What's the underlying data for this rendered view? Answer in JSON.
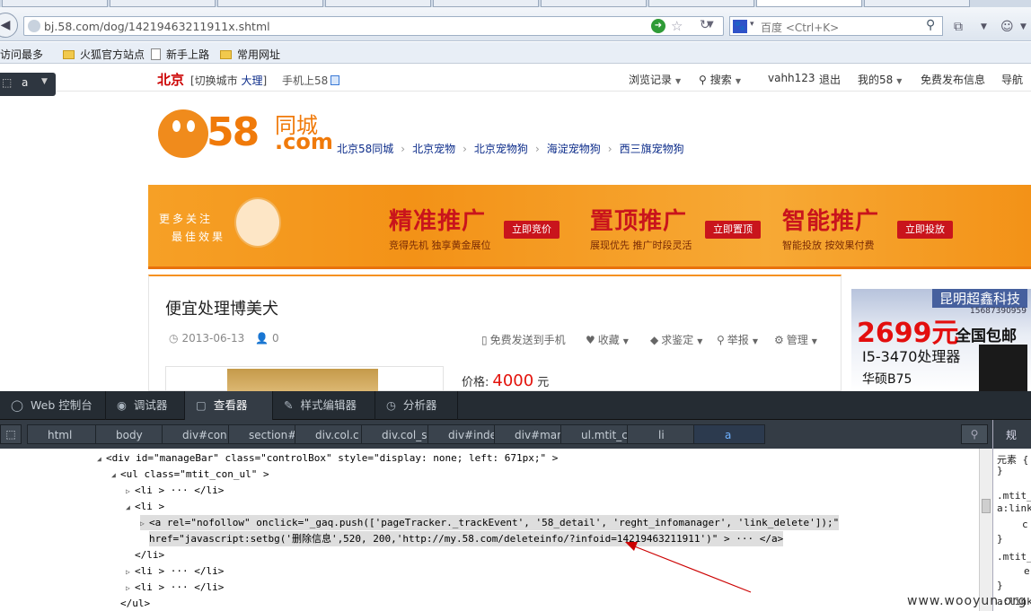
{
  "browser": {
    "url": "bj.58.com/dog/14219463211911x.shtml",
    "search_engine": "百度",
    "search_placeholder": "百度 <Ctrl+K>",
    "bookmarks": [
      "访问最多",
      "火狐官方站点",
      "新手上路",
      "常用网址"
    ]
  },
  "site": {
    "city": "北京",
    "switch_prefix": "[切换城市",
    "switch_city": "大理",
    "switch_suffix": "]",
    "mobile": "手机上58",
    "topnav": [
      "浏览记录",
      "搜索",
      "vahh123",
      "退出",
      "我的58",
      "免费发布信息",
      "导航"
    ],
    "logo_num": "58",
    "logo_cn": "同城",
    "logo_com": ".com",
    "breadcrumb": [
      "北京58同城",
      "北京宠物",
      "北京宠物狗",
      "海淀宠物狗",
      "西三旗宠物狗"
    ],
    "breadcrumb_sep": "›",
    "banner": {
      "side_line1": "更多关注",
      "side_line2": "最佳效果",
      "promos": [
        {
          "big": "精准推广",
          "small": "竞得先机 独享黄金展位",
          "btn": "立即竞价"
        },
        {
          "big": "置顶推广",
          "small": "展现优先 推广时段灵活",
          "btn": "立即置顶"
        },
        {
          "big": "智能推广",
          "small": "智能投放 按效果付费",
          "btn": "立即投放"
        }
      ]
    },
    "post": {
      "title": "便宜处理博美犬",
      "date": "2013-06-13",
      "views": "0",
      "actions": [
        "免费发送到手机",
        "收藏",
        "求鉴定",
        "举报",
        "管理"
      ],
      "price_label": "价格:",
      "price_value": "4000",
      "price_unit": "元"
    },
    "ad": {
      "company": "昆明超鑫科技",
      "phone": "15687390959",
      "price": "2699元",
      "all": "全国包邮",
      "cpu": "I5-3470处理器",
      "board": "华硕B75"
    }
  },
  "devtools": {
    "tabs": [
      {
        "icon": "◯",
        "label": "Web 控制台"
      },
      {
        "icon": "◉",
        "label": "调试器"
      },
      {
        "icon": "▢",
        "label": "查看器"
      },
      {
        "icon": "✎",
        "label": "样式编辑器"
      },
      {
        "icon": "◷",
        "label": "分析器"
      }
    ],
    "crumbs": [
      "html",
      "body",
      "div#con",
      "section#",
      "div.col.c",
      "div.col_s",
      "div#inde",
      "div#mar",
      "ul.mtit_c",
      "li",
      "a"
    ],
    "right_header": "规",
    "right_lines": [
      "元素 {",
      "}",
      ".mtit_",
      "a:link",
      "c",
      "}",
      ".mtit_",
      "e",
      "}",
      "a:link"
    ],
    "tree": [
      {
        "indent": 108,
        "tw": "◢",
        "text": "<div id=\"manageBar\" class=\"controlBox\" style=\"display: none; left: 671px;\" >"
      },
      {
        "indent": 124,
        "tw": "◢",
        "text": "<ul class=\"mtit_con_ul\" >"
      },
      {
        "indent": 140,
        "tw": "▷",
        "text": "<li > ··· </li>"
      },
      {
        "indent": 140,
        "tw": "◢",
        "text": "<li >"
      },
      {
        "indent": 156,
        "tw": "▷",
        "text": "<a rel=\"nofollow\" onclick=\"_gaq.push(['pageTracker._trackEvent', '58_detail', 'reght_infomanager', 'link_delete']);\""
      },
      {
        "indent": 166,
        "tw": "",
        "text": "href=\"javascript:setbg('删除信息',520, 200,'http://my.58.com/deleteinfo/?infoid=14219463211911')\" > ··· </a>"
      },
      {
        "indent": 150,
        "tw": "",
        "text": "</li>"
      },
      {
        "indent": 140,
        "tw": "▷",
        "text": "<li > ··· </li>"
      },
      {
        "indent": 140,
        "tw": "▷",
        "text": "<li > ··· </li>"
      },
      {
        "indent": 134,
        "tw": "",
        "text": "</ul>"
      }
    ]
  },
  "watermark": "www.wooyun.org"
}
